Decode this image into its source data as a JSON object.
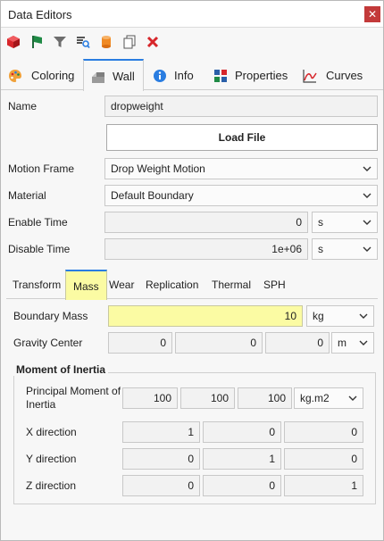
{
  "window": {
    "title": "Data Editors"
  },
  "toolbar": {
    "icons": [
      "cube-icon",
      "flag-icon",
      "funnel-icon",
      "search-table-icon",
      "cylinder-icon",
      "copy-icon",
      "delete-icon"
    ]
  },
  "main_tabs": [
    {
      "label": "Coloring",
      "icon": "palette-icon"
    },
    {
      "label": "Wall",
      "icon": "wall-icon"
    },
    {
      "label": "Info",
      "icon": "info-icon"
    },
    {
      "label": "Properties",
      "icon": "properties-icon"
    },
    {
      "label": "Curves",
      "icon": "curve-chart-icon"
    }
  ],
  "wall": {
    "name_label": "Name",
    "name_value": "dropweight",
    "load_file_label": "Load File",
    "motion_frame_label": "Motion Frame",
    "motion_frame_value": "Drop Weight Motion",
    "material_label": "Material",
    "material_value": "Default Boundary",
    "enable_time_label": "Enable Time",
    "enable_time_value": "0",
    "enable_time_unit": "s",
    "disable_time_label": "Disable Time",
    "disable_time_value": "1e+06",
    "disable_time_unit": "s"
  },
  "sub_tabs": [
    "Transform",
    "Mass",
    "Wear",
    "Replication",
    "Thermal",
    "SPH"
  ],
  "mass": {
    "boundary_mass_label": "Boundary Mass",
    "boundary_mass_value": "10",
    "boundary_mass_unit": "kg",
    "gravity_center_label": "Gravity Center",
    "gravity_center": [
      "0",
      "0",
      "0"
    ],
    "gravity_center_unit": "m",
    "moment_title": "Moment of Inertia",
    "principal_label": "Principal Moment of Inertia",
    "principal_values": [
      "100",
      "100",
      "100"
    ],
    "principal_unit": "kg.m2",
    "x_label": "X direction",
    "x_values": [
      "1",
      "0",
      "0"
    ],
    "y_label": "Y direction",
    "y_values": [
      "0",
      "1",
      "0"
    ],
    "z_label": "Z direction",
    "z_values": [
      "0",
      "0",
      "1"
    ]
  }
}
